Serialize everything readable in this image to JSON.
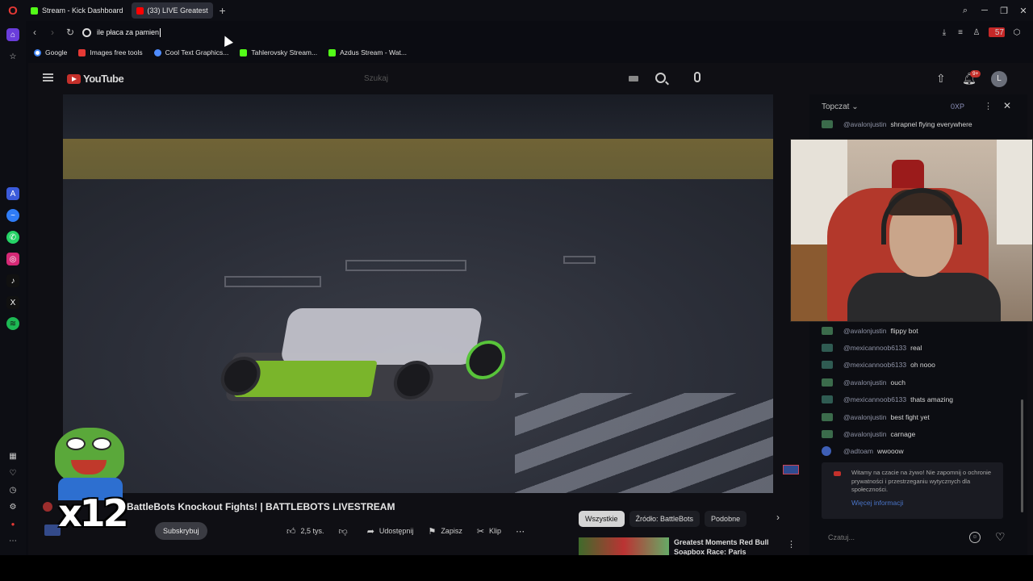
{
  "browser": {
    "tabs": [
      {
        "label": "Stream - Kick Dashboard",
        "icon": "kick-icon"
      },
      {
        "label": "(33)  LIVE Greatest",
        "icon": "youtube-icon"
      }
    ],
    "address": "ile płaca za pamien",
    "bookmarks": [
      {
        "label": "Google",
        "icon": "google-icon"
      },
      {
        "label": "Images free tools",
        "icon": "bookmark-icon"
      },
      {
        "label": "Cool Text Graphics...",
        "icon": "cooltext-icon"
      },
      {
        "label": "Tahlerovsky Stream...",
        "icon": "kick-icon"
      },
      {
        "label": "Azdus Stream - Wat...",
        "icon": "kick-icon"
      }
    ],
    "vpn_badge": "57"
  },
  "youtube": {
    "logo": "YouTube",
    "search_placeholder": "Szukaj",
    "notifications": "9+",
    "avatar_letter": "L",
    "video_title": "BattleBots Knockout Fights! | BATTLEBOTS LIVESTREAM",
    "subscribe": "Subskrybuj",
    "actions": {
      "likes": "2,5 tys.",
      "share": "Udostępnij",
      "save": "Zapisz",
      "clip": "Klip"
    },
    "chips": [
      "Wszystkie",
      "Źródło: BattleBots",
      "Podobne"
    ],
    "recommended_title": "Greatest Moments Red Bull Soapbox Race: Paris"
  },
  "overlay": {
    "emote_count": "x12"
  },
  "chat": {
    "title": "Topczat",
    "xp": "0XP",
    "messages": [
      {
        "user": "@avalonjustin",
        "text": "shrapnel flying everywhere"
      },
      {
        "user": "@avalonjustin",
        "text": "flippy bot"
      },
      {
        "user": "@mexicannoob6133",
        "text": "real"
      },
      {
        "user": "@mexicannoob6133",
        "text": "oh nooo"
      },
      {
        "user": "@avalonjustin",
        "text": "ouch"
      },
      {
        "user": "@mexicannoob6133",
        "text": "thats amazing"
      },
      {
        "user": "@avalonjustin",
        "text": "best fight yet"
      },
      {
        "user": "@avalonjustin",
        "text": "carnage"
      },
      {
        "user": "@adtoam",
        "text": "wwooow"
      }
    ],
    "notice": "Witamy na czacie na żywo! Nie zapomnij o ochronie prywatności i przestrzeganiu wytycznych dla społeczności.",
    "notice_link": "Więcej informacji",
    "input_placeholder": "Czatuj..."
  }
}
